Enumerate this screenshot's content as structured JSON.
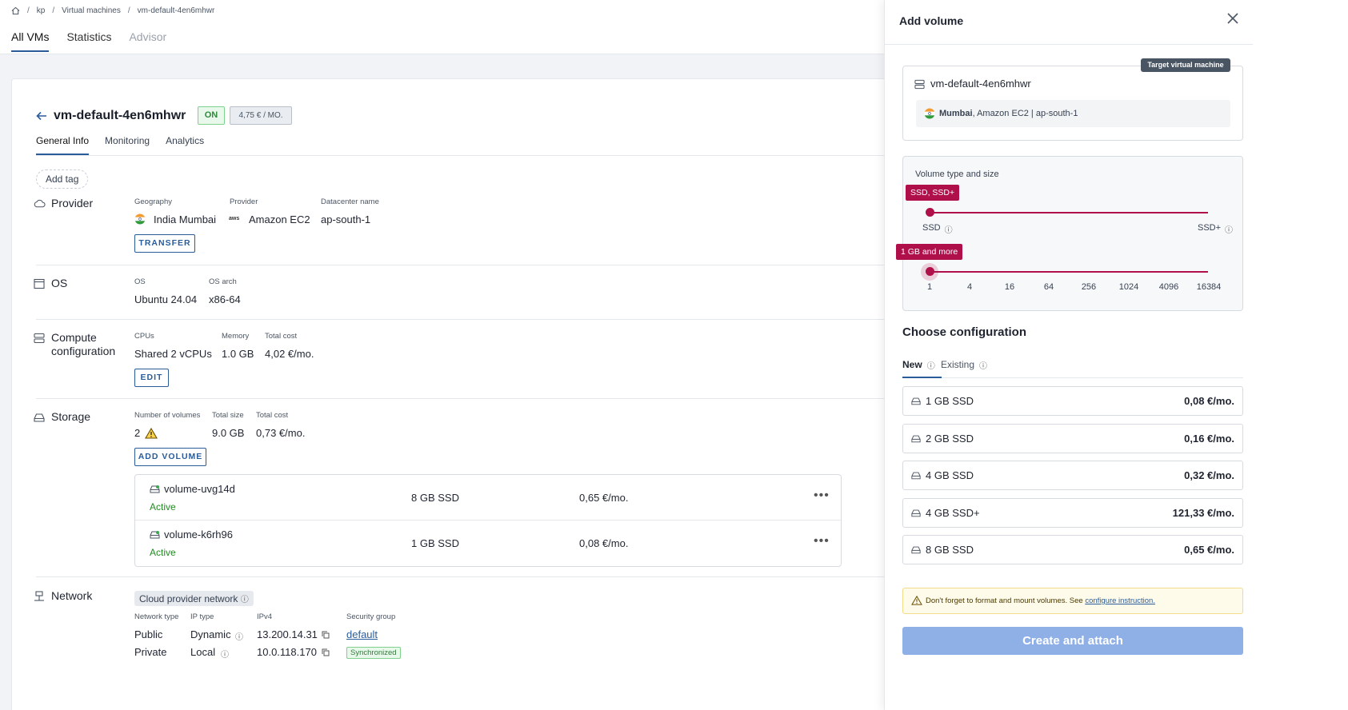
{
  "breadcrumb": {
    "items": [
      "kp",
      "Virtual machines",
      "vm-default-4en6mhwr"
    ]
  },
  "top_tabs": [
    {
      "label": "All VMs"
    },
    {
      "label": "Statistics"
    },
    {
      "label": "Advisor"
    }
  ],
  "vm": {
    "name": "vm-default-4en6mhwr",
    "status": "ON",
    "price": "4,75 € / MO.",
    "tabs": [
      "General Info",
      "Monitoring",
      "Analytics"
    ],
    "add_tag": "Add tag"
  },
  "provider": {
    "title": "Provider",
    "labels": [
      "Geography",
      "Provider",
      "Datacenter name"
    ],
    "geography": "India Mumbai",
    "provider": "Amazon EC2",
    "datacenter": "ap-south-1",
    "transfer_label": "TRANSFER"
  },
  "os": {
    "title": "OS",
    "labels": [
      "OS",
      "OS arch"
    ],
    "os": "Ubuntu 24.04",
    "arch": "x86-64"
  },
  "compute": {
    "title_line1": "Compute",
    "title_line2": "configuration",
    "labels": [
      "CPUs",
      "Memory",
      "Total cost"
    ],
    "cpus": "Shared 2 vCPUs",
    "memory": "1.0 GB",
    "cost": "4,02 €/mo.",
    "edit_label": "EDIT"
  },
  "storage": {
    "title": "Storage",
    "labels": [
      "Number of volumes",
      "Total size",
      "Total cost"
    ],
    "count": "2",
    "size": "9.0 GB",
    "cost": "0,73 €/mo.",
    "add_volume_label": "ADD VOLUME",
    "volumes": [
      {
        "name": "volume-uvg14d",
        "status": "Active",
        "size": "8 GB SSD",
        "cost": "0,65 €/mo."
      },
      {
        "name": "volume-k6rh96",
        "status": "Active",
        "size": "1 GB SSD",
        "cost": "0,08 €/mo."
      }
    ]
  },
  "network": {
    "title": "Network",
    "chip": "Cloud provider network",
    "labels": [
      "Network type",
      "IP type",
      "IPv4",
      "Security group"
    ],
    "rows": [
      {
        "type": "Public",
        "ip_type": "Dynamic",
        "ipv4": "13.200.14.31",
        "group": "default"
      },
      {
        "type": "Private",
        "ip_type": "Local",
        "ipv4": "10.0.118.170",
        "group": "Synchronized"
      }
    ]
  },
  "panel": {
    "title": "Add volume",
    "target_badge": "Target virtual machine",
    "vm_name": "vm-default-4en6mhwr",
    "location_city": "Mumbai",
    "location_rest": ", Amazon EC2 | ap-south-1",
    "volume_section_label": "Volume type and size",
    "type_tooltip": "SSD, SSD+",
    "type_min": "SSD",
    "type_max": "SSD+",
    "size_tooltip": "1 GB and more",
    "size_ticks": [
      "1",
      "4",
      "16",
      "64",
      "256",
      "1024",
      "4096",
      "16384"
    ],
    "config_title": "Choose configuration",
    "config_tabs": [
      "New",
      "Existing"
    ],
    "configs": [
      {
        "name": "1 GB SSD",
        "price": "0,08 €/mo."
      },
      {
        "name": "2 GB SSD",
        "price": "0,16 €/mo."
      },
      {
        "name": "4 GB SSD",
        "price": "0,32 €/mo."
      },
      {
        "name": "4 GB SSD+",
        "price": "121,33 €/mo."
      },
      {
        "name": "8 GB SSD",
        "price": "0,65 €/mo."
      }
    ],
    "warning_text": "Don't forget to format and mount volumes. See ",
    "warning_link": "configure instruction.",
    "submit_label": "Create and attach"
  },
  "colors": {
    "accent": "#2a5c9a",
    "slider": "#b0104a",
    "cta": "#8fb0e6",
    "active": "#228b22"
  }
}
